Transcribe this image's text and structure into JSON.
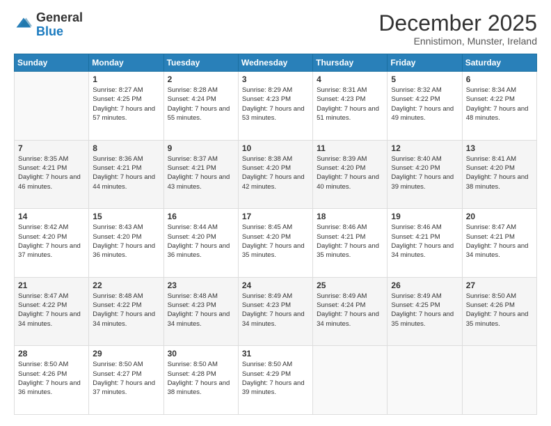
{
  "header": {
    "logo_general": "General",
    "logo_blue": "Blue",
    "month_title": "December 2025",
    "location": "Ennistimon, Munster, Ireland"
  },
  "days_of_week": [
    "Sunday",
    "Monday",
    "Tuesday",
    "Wednesday",
    "Thursday",
    "Friday",
    "Saturday"
  ],
  "weeks": [
    [
      {
        "day": "",
        "sunrise": "",
        "sunset": "",
        "daylight": ""
      },
      {
        "day": "1",
        "sunrise": "Sunrise: 8:27 AM",
        "sunset": "Sunset: 4:25 PM",
        "daylight": "Daylight: 7 hours and 57 minutes."
      },
      {
        "day": "2",
        "sunrise": "Sunrise: 8:28 AM",
        "sunset": "Sunset: 4:24 PM",
        "daylight": "Daylight: 7 hours and 55 minutes."
      },
      {
        "day": "3",
        "sunrise": "Sunrise: 8:29 AM",
        "sunset": "Sunset: 4:23 PM",
        "daylight": "Daylight: 7 hours and 53 minutes."
      },
      {
        "day": "4",
        "sunrise": "Sunrise: 8:31 AM",
        "sunset": "Sunset: 4:23 PM",
        "daylight": "Daylight: 7 hours and 51 minutes."
      },
      {
        "day": "5",
        "sunrise": "Sunrise: 8:32 AM",
        "sunset": "Sunset: 4:22 PM",
        "daylight": "Daylight: 7 hours and 49 minutes."
      },
      {
        "day": "6",
        "sunrise": "Sunrise: 8:34 AM",
        "sunset": "Sunset: 4:22 PM",
        "daylight": "Daylight: 7 hours and 48 minutes."
      }
    ],
    [
      {
        "day": "7",
        "sunrise": "Sunrise: 8:35 AM",
        "sunset": "Sunset: 4:21 PM",
        "daylight": "Daylight: 7 hours and 46 minutes."
      },
      {
        "day": "8",
        "sunrise": "Sunrise: 8:36 AM",
        "sunset": "Sunset: 4:21 PM",
        "daylight": "Daylight: 7 hours and 44 minutes."
      },
      {
        "day": "9",
        "sunrise": "Sunrise: 8:37 AM",
        "sunset": "Sunset: 4:21 PM",
        "daylight": "Daylight: 7 hours and 43 minutes."
      },
      {
        "day": "10",
        "sunrise": "Sunrise: 8:38 AM",
        "sunset": "Sunset: 4:20 PM",
        "daylight": "Daylight: 7 hours and 42 minutes."
      },
      {
        "day": "11",
        "sunrise": "Sunrise: 8:39 AM",
        "sunset": "Sunset: 4:20 PM",
        "daylight": "Daylight: 7 hours and 40 minutes."
      },
      {
        "day": "12",
        "sunrise": "Sunrise: 8:40 AM",
        "sunset": "Sunset: 4:20 PM",
        "daylight": "Daylight: 7 hours and 39 minutes."
      },
      {
        "day": "13",
        "sunrise": "Sunrise: 8:41 AM",
        "sunset": "Sunset: 4:20 PM",
        "daylight": "Daylight: 7 hours and 38 minutes."
      }
    ],
    [
      {
        "day": "14",
        "sunrise": "Sunrise: 8:42 AM",
        "sunset": "Sunset: 4:20 PM",
        "daylight": "Daylight: 7 hours and 37 minutes."
      },
      {
        "day": "15",
        "sunrise": "Sunrise: 8:43 AM",
        "sunset": "Sunset: 4:20 PM",
        "daylight": "Daylight: 7 hours and 36 minutes."
      },
      {
        "day": "16",
        "sunrise": "Sunrise: 8:44 AM",
        "sunset": "Sunset: 4:20 PM",
        "daylight": "Daylight: 7 hours and 36 minutes."
      },
      {
        "day": "17",
        "sunrise": "Sunrise: 8:45 AM",
        "sunset": "Sunset: 4:20 PM",
        "daylight": "Daylight: 7 hours and 35 minutes."
      },
      {
        "day": "18",
        "sunrise": "Sunrise: 8:46 AM",
        "sunset": "Sunset: 4:21 PM",
        "daylight": "Daylight: 7 hours and 35 minutes."
      },
      {
        "day": "19",
        "sunrise": "Sunrise: 8:46 AM",
        "sunset": "Sunset: 4:21 PM",
        "daylight": "Daylight: 7 hours and 34 minutes."
      },
      {
        "day": "20",
        "sunrise": "Sunrise: 8:47 AM",
        "sunset": "Sunset: 4:21 PM",
        "daylight": "Daylight: 7 hours and 34 minutes."
      }
    ],
    [
      {
        "day": "21",
        "sunrise": "Sunrise: 8:47 AM",
        "sunset": "Sunset: 4:22 PM",
        "daylight": "Daylight: 7 hours and 34 minutes."
      },
      {
        "day": "22",
        "sunrise": "Sunrise: 8:48 AM",
        "sunset": "Sunset: 4:22 PM",
        "daylight": "Daylight: 7 hours and 34 minutes."
      },
      {
        "day": "23",
        "sunrise": "Sunrise: 8:48 AM",
        "sunset": "Sunset: 4:23 PM",
        "daylight": "Daylight: 7 hours and 34 minutes."
      },
      {
        "day": "24",
        "sunrise": "Sunrise: 8:49 AM",
        "sunset": "Sunset: 4:23 PM",
        "daylight": "Daylight: 7 hours and 34 minutes."
      },
      {
        "day": "25",
        "sunrise": "Sunrise: 8:49 AM",
        "sunset": "Sunset: 4:24 PM",
        "daylight": "Daylight: 7 hours and 34 minutes."
      },
      {
        "day": "26",
        "sunrise": "Sunrise: 8:49 AM",
        "sunset": "Sunset: 4:25 PM",
        "daylight": "Daylight: 7 hours and 35 minutes."
      },
      {
        "day": "27",
        "sunrise": "Sunrise: 8:50 AM",
        "sunset": "Sunset: 4:26 PM",
        "daylight": "Daylight: 7 hours and 35 minutes."
      }
    ],
    [
      {
        "day": "28",
        "sunrise": "Sunrise: 8:50 AM",
        "sunset": "Sunset: 4:26 PM",
        "daylight": "Daylight: 7 hours and 36 minutes."
      },
      {
        "day": "29",
        "sunrise": "Sunrise: 8:50 AM",
        "sunset": "Sunset: 4:27 PM",
        "daylight": "Daylight: 7 hours and 37 minutes."
      },
      {
        "day": "30",
        "sunrise": "Sunrise: 8:50 AM",
        "sunset": "Sunset: 4:28 PM",
        "daylight": "Daylight: 7 hours and 38 minutes."
      },
      {
        "day": "31",
        "sunrise": "Sunrise: 8:50 AM",
        "sunset": "Sunset: 4:29 PM",
        "daylight": "Daylight: 7 hours and 39 minutes."
      },
      {
        "day": "",
        "sunrise": "",
        "sunset": "",
        "daylight": ""
      },
      {
        "day": "",
        "sunrise": "",
        "sunset": "",
        "daylight": ""
      },
      {
        "day": "",
        "sunrise": "",
        "sunset": "",
        "daylight": ""
      }
    ]
  ]
}
